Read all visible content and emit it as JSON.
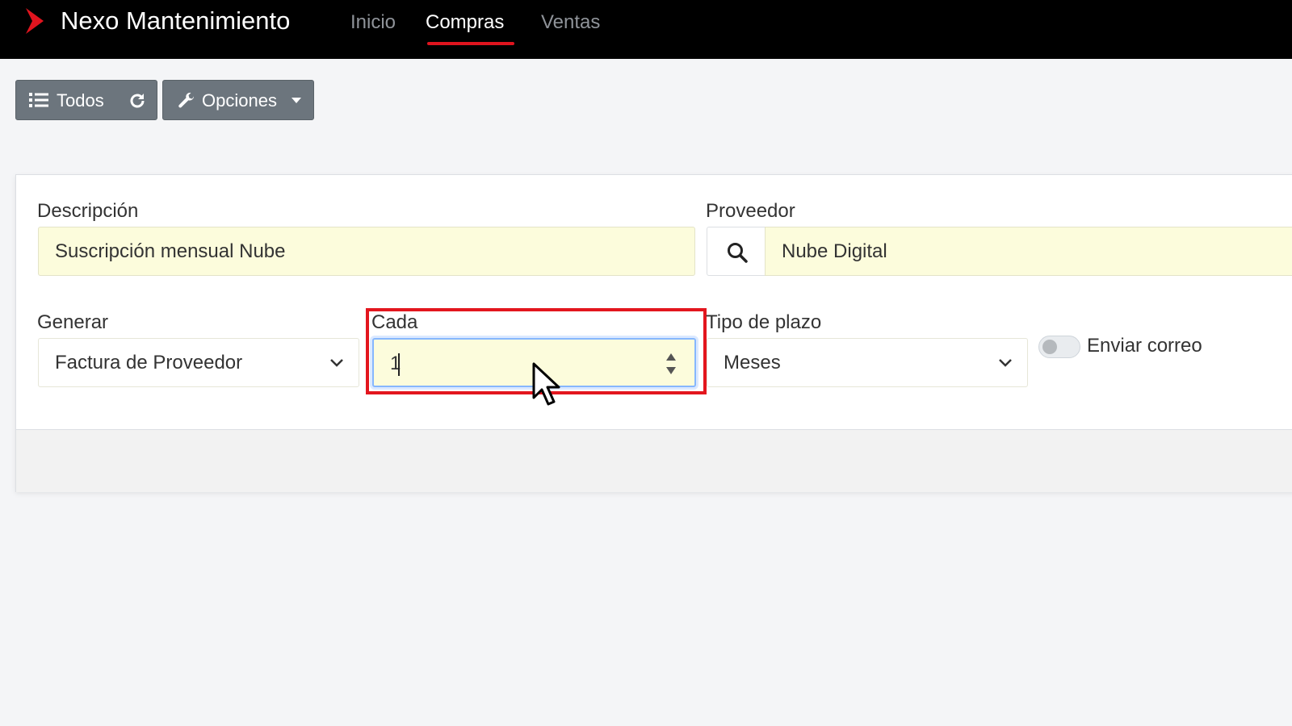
{
  "app": {
    "title": "Nexo Mantenimiento",
    "brand_color": "#e0141e"
  },
  "nav": {
    "items": [
      {
        "label": "Inicio",
        "active": false
      },
      {
        "label": "Compras",
        "active": true
      },
      {
        "label": "Ventas",
        "active": false
      }
    ]
  },
  "toolbar": {
    "todos_label": "Todos",
    "todos_icon": "list-icon",
    "refresh_icon": "refresh-icon",
    "options_label": "Opciones",
    "options_icon": "wrench-icon"
  },
  "form": {
    "descripcion": {
      "label": "Descripción",
      "value": "Suscripción mensual Nube"
    },
    "proveedor": {
      "label": "Proveedor",
      "value": "Nube Digital",
      "search_icon": "search-icon"
    },
    "generar": {
      "label": "Generar",
      "value": "Factura de Proveedor"
    },
    "cada": {
      "label": "Cada",
      "value": "1"
    },
    "tipo_plazo": {
      "label": "Tipo de plazo",
      "value": "Meses"
    },
    "enviar_correo": {
      "label": "Enviar correo",
      "checked": false
    }
  },
  "colors": {
    "input_bg": "#fcfcdc",
    "highlight": "#e3161e",
    "button_bg": "#6c757d"
  }
}
